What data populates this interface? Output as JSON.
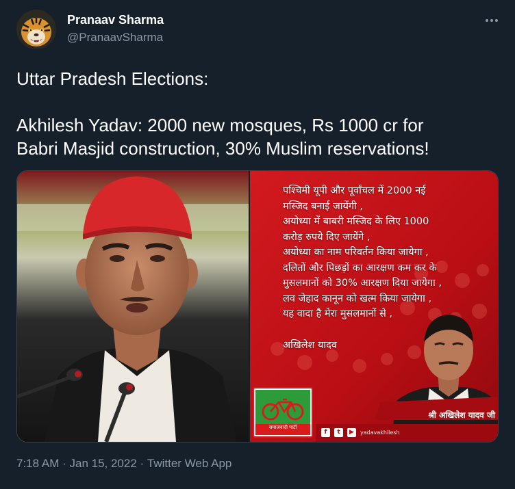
{
  "tweet": {
    "author": {
      "name": "Pranaav Sharma",
      "handle": "@PranaavSharma",
      "avatar_icon": "tiger-avatar"
    },
    "more_icon": "more-options-icon",
    "text_lines": [
      "Uttar Pradesh Elections:",
      "Akhilesh Yadav: 2000 new mosques, Rs 1000 cr for",
      "Babri Masjid construction, 30% Muslim reservations!"
    ],
    "media": {
      "poster_lines": [
        "पश्चिमी यूपी और पूर्वांचल में 2000 नई",
        "मस्जिद बनाई जायेंगी ,",
        "अयोध्या में बाबरी मस्जिद के लिए 1000",
        "करोड़ रुपये दिए जायेंगे ,",
        "अयोध्या का नाम परिवर्तन किया जायेगा ,",
        "दलितों और पिछड़ों का आरक्षण कम कर के",
        "मुसलमानों को 30% आरक्षण दिया जायेगा ,",
        "लव जेहाद कानून को खत्म किया जायेगा ,",
        "यह वादा है मेरा मुसलमानों से ,"
      ],
      "poster_signature": "अखिलेश यादव",
      "poster_caption": "श्री अखिलेश यादव जी",
      "poster_logo_text": "समाजवादी पार्टी",
      "poster_social": "yadavakhilesh",
      "colors": {
        "poster_red": "#c40c13",
        "cap_red": "#d8272b",
        "party_green": "#2e9b3b"
      }
    },
    "meta": {
      "time": "7:18 AM",
      "separator": " · ",
      "date": "Jan 15, 2022",
      "app": "Twitter Web App"
    }
  },
  "colors": {
    "background": "#15202b",
    "text_primary": "#ffffff",
    "text_secondary": "#8b98a5",
    "border": "#38444d"
  }
}
